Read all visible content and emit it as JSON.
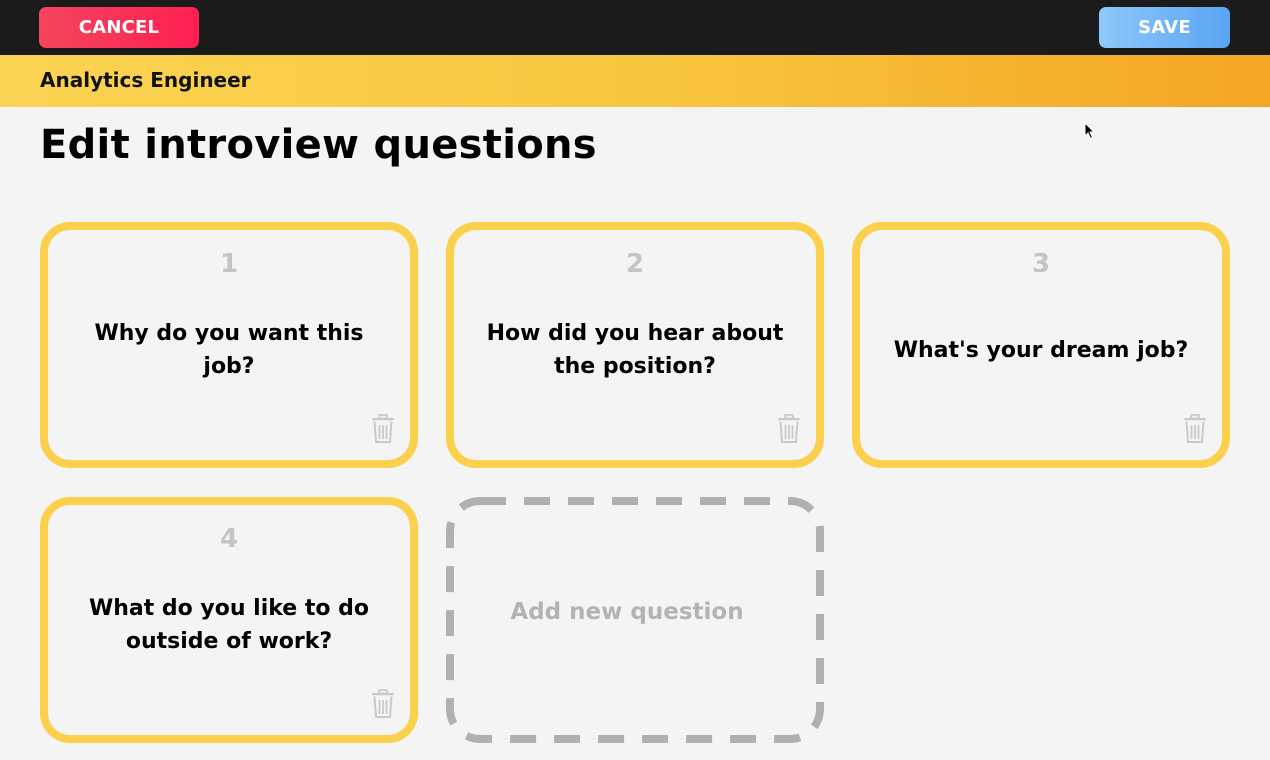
{
  "toolbar": {
    "cancel_label": "CANCEL",
    "save_label": "SAVE"
  },
  "banner": {
    "job_title": "Analytics Engineer"
  },
  "page": {
    "title": "Edit introview questions"
  },
  "questions": [
    {
      "number": "1",
      "text": "Why do you want this job?",
      "delete_icon": "trash-icon"
    },
    {
      "number": "2",
      "text": "How did you hear about the position?",
      "delete_icon": "trash-icon"
    },
    {
      "number": "3",
      "text": "What's your dream job?",
      "delete_icon": "trash-icon"
    },
    {
      "number": "4",
      "text": "What do you like to do outside of work?",
      "delete_icon": "trash-icon"
    }
  ],
  "add_question": {
    "label": "Add new question"
  },
  "colors": {
    "cancel": "#ff2b55",
    "save": "#6aaef5",
    "card_border": "#fbd04d",
    "banner_start": "#fbd352",
    "banner_end": "#f4a524"
  }
}
